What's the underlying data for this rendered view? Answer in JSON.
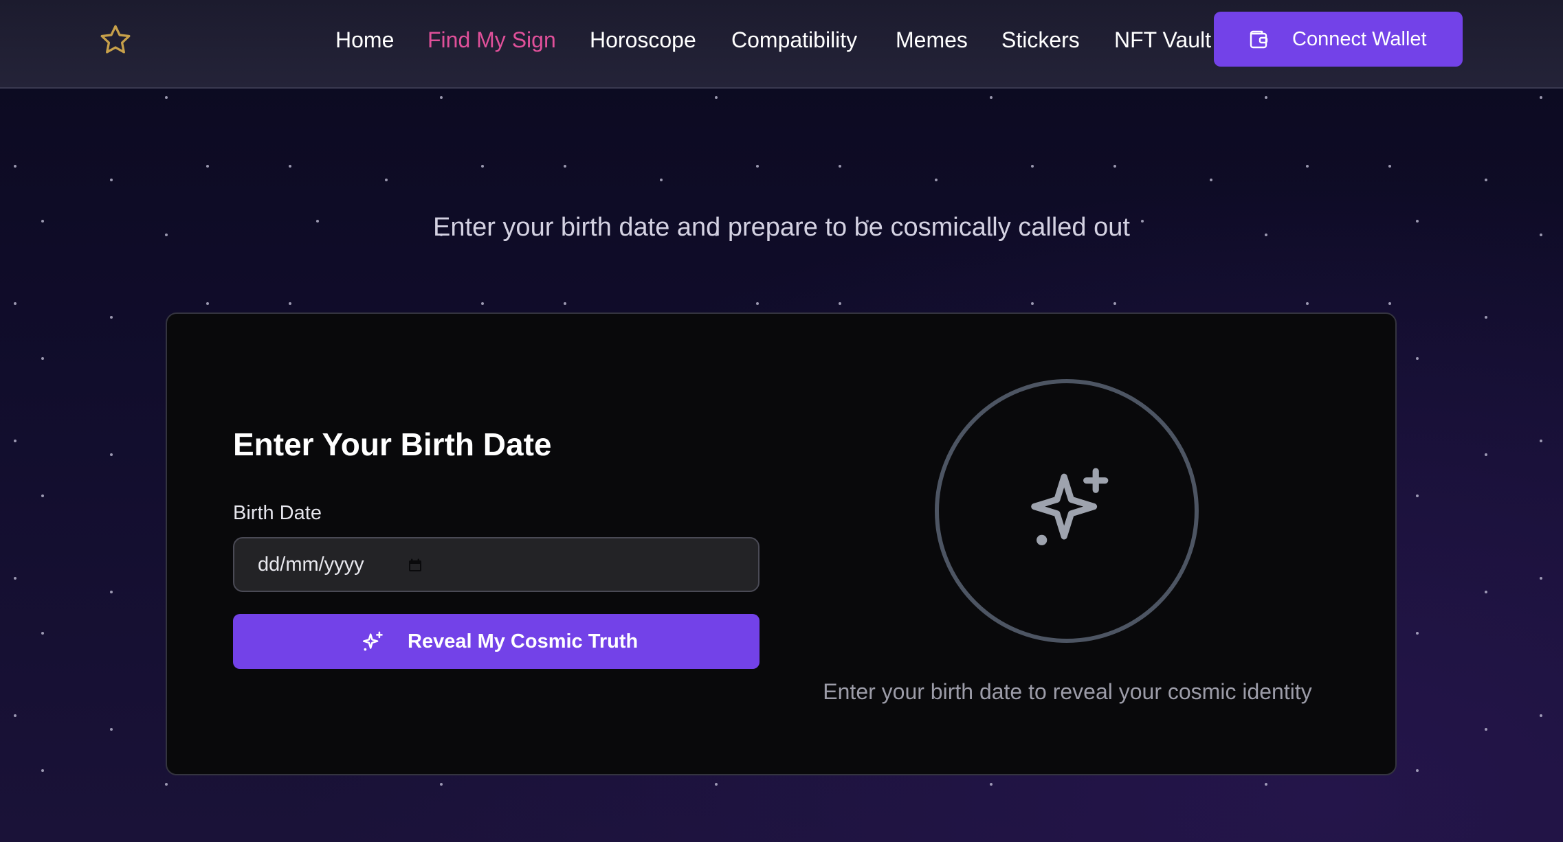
{
  "header": {
    "nav": [
      {
        "label": "Home"
      },
      {
        "label": "Find My Sign"
      },
      {
        "label": "Horoscope"
      },
      {
        "label": "Compatibility"
      },
      {
        "label": "Memes"
      },
      {
        "label": "Stickers"
      },
      {
        "label": "NFT Vault"
      }
    ],
    "active_nav": "Find My Sign",
    "logo_icon": "star-outline-icon",
    "wallet_button": {
      "label": "Connect Wallet",
      "icon": "wallet-icon"
    }
  },
  "hero": {
    "tagline": "Enter your birth date and prepare to be cosmically called out"
  },
  "form": {
    "title": "Enter Your Birth Date",
    "field_label": "Birth Date",
    "date_placeholder": "dd/mm/yyyy",
    "date_value": "",
    "calendar_icon": "calendar-icon",
    "submit_label": "Reveal My Cosmic Truth",
    "submit_icon": "sparkles-icon"
  },
  "result": {
    "icon": "sparkles-icon",
    "hint": "Enter your birth date to reveal your cosmic identity"
  },
  "colors": {
    "accent": "#7342e8",
    "active_nav": "#e0509a",
    "logo_star": "#c7a04a",
    "background": "#110d2c",
    "card": "#09090b",
    "circle_border": "#4d5563"
  }
}
